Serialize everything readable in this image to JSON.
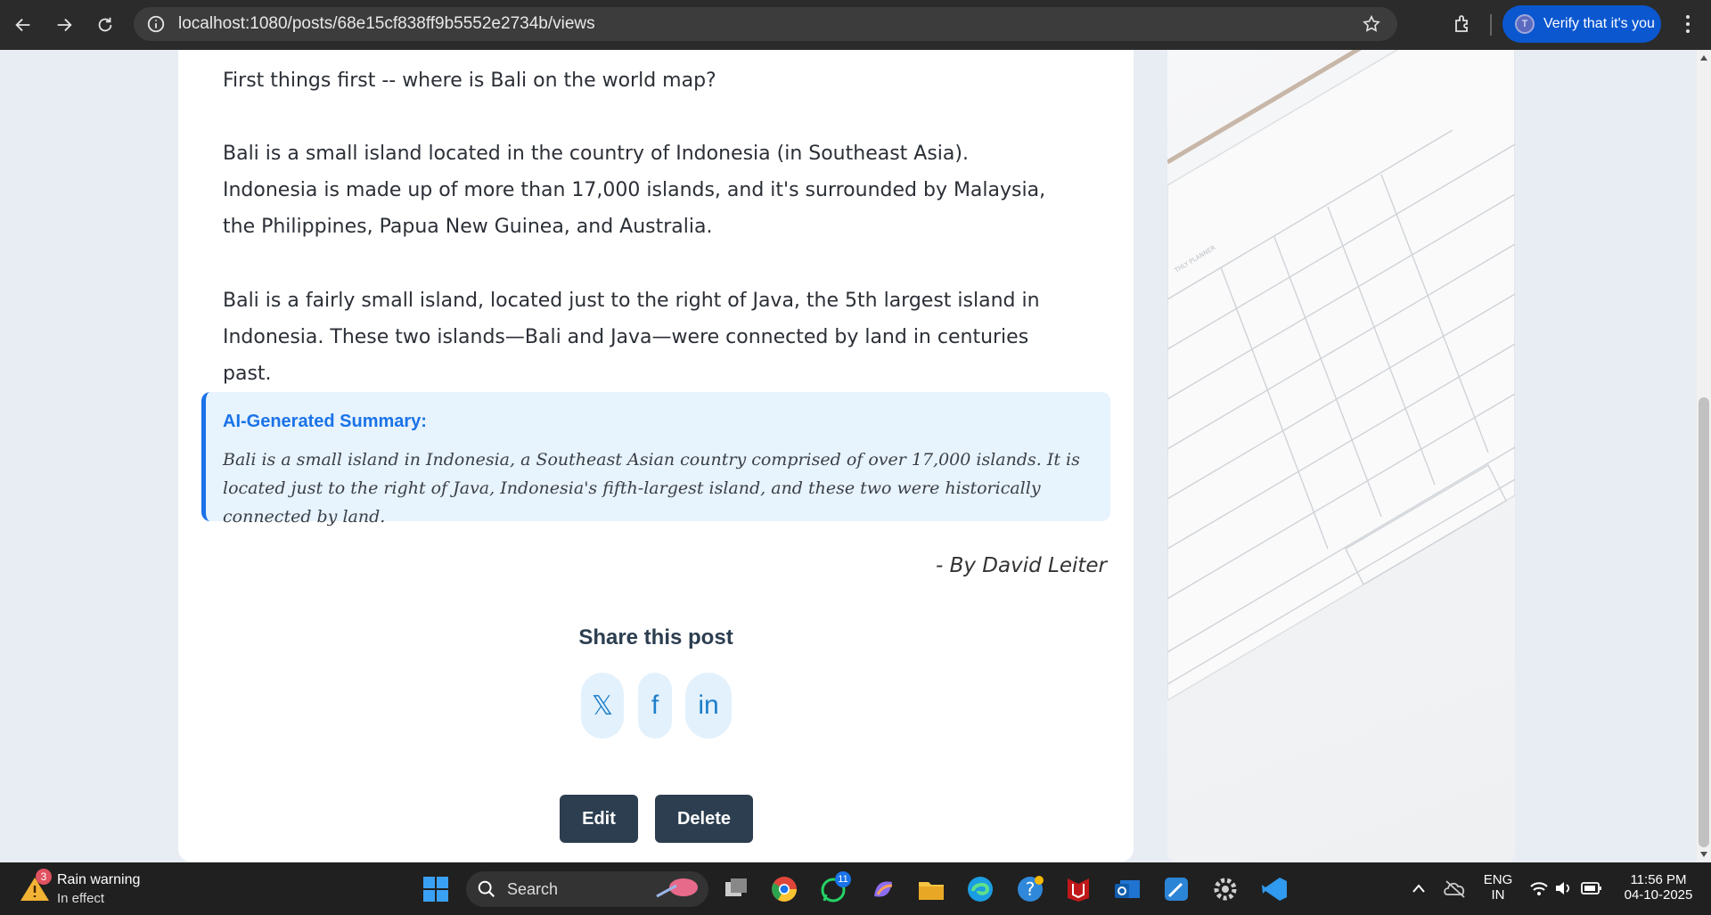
{
  "browser": {
    "url": "localhost:1080/posts/68e15cf838ff9b5552e2734b/views",
    "profile_button_label": "Verify that it's you",
    "profile_initial": "T"
  },
  "post": {
    "paragraphs": [
      "First things first -- where is Bali on the world map?",
      "Bali is a small island located in the country of Indonesia (in Southeast Asia). Indonesia is made up of more than 17,000 islands, and it's surrounded by Malaysia, the Philippines, Papua New Guinea, and Australia.",
      "Bali is a fairly small island, located just to the right of Java, the 5th largest island in Indonesia. These two islands—Bali and Java—were connected by land in centuries past."
    ],
    "summary": {
      "title": "AI-Generated Summary:",
      "text": "Bali is a small island in Indonesia, a Southeast Asian country comprised of over 17,000 islands. It is located just to the right of Java, Indonesia's fifth-largest island, and these two were historically connected by land."
    },
    "byline": "- By David Leiter",
    "share": {
      "title": "Share this post",
      "buttons": [
        {
          "label": "𝕏",
          "name": "x"
        },
        {
          "label": "f",
          "name": "facebook"
        },
        {
          "label": "in",
          "name": "linkedin"
        }
      ]
    },
    "actions": {
      "edit": "Edit",
      "delete": "Delete"
    }
  },
  "taskbar": {
    "weather": {
      "badge": "3",
      "title": "Rain warning",
      "subtitle": "In effect"
    },
    "search_label": "Search",
    "whatsapp_badge": "11",
    "language": {
      "line1": "ENG",
      "line2": "IN"
    },
    "clock": {
      "time": "11:56 PM",
      "date": "04-10-2025"
    }
  },
  "colors": {
    "accent": "#1a73e8",
    "button": "#2c3e50",
    "summary_bg": "#e7f3fd"
  }
}
